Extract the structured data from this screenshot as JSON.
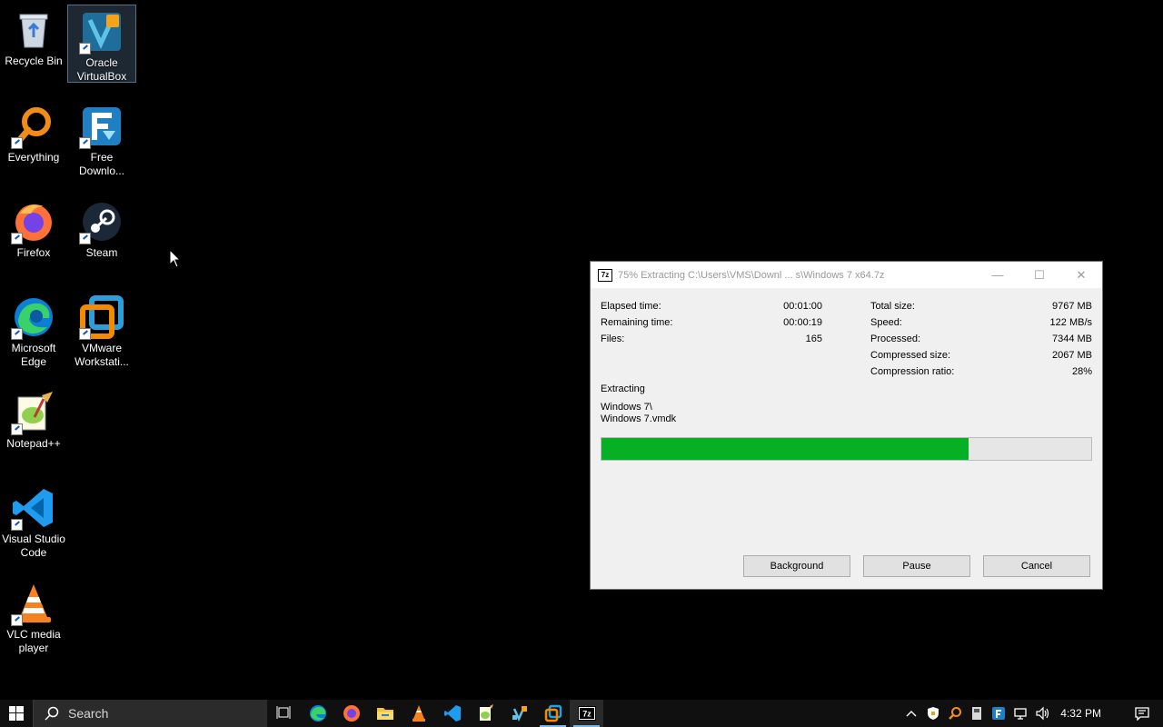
{
  "desktop": {
    "icons": [
      {
        "label": "Recycle Bin"
      },
      {
        "label": "Oracle VirtualBox"
      },
      {
        "label": "Everything"
      },
      {
        "label": "Free Downlo..."
      },
      {
        "label": "Firefox"
      },
      {
        "label": "Steam"
      },
      {
        "label": "Microsoft Edge"
      },
      {
        "label": "VMware Workstati..."
      },
      {
        "label": "Notepad++"
      },
      {
        "label": "Visual Studio Code"
      },
      {
        "label": "VLC media player"
      }
    ]
  },
  "dialog": {
    "app_icon_text": "7z",
    "title": "75% Extracting C:\\Users\\VMS\\Downl ... s\\Windows 7 x64.7z",
    "controls": {
      "minimize": "—",
      "maximize": "☐",
      "close": "✕"
    },
    "left_stats": [
      {
        "label": "Elapsed time:",
        "value": "00:01:00"
      },
      {
        "label": "Remaining time:",
        "value": "00:00:19"
      },
      {
        "label": "Files:",
        "value": "165"
      }
    ],
    "right_stats": [
      {
        "label": "Total size:",
        "value": "9767 MB"
      },
      {
        "label": "Speed:",
        "value": "122 MB/s"
      },
      {
        "label": "Processed:",
        "value": "7344 MB"
      },
      {
        "label": "Compressed size:",
        "value": "2067 MB"
      },
      {
        "label": "Compression ratio:",
        "value": "28%"
      }
    ],
    "status": "Extracting",
    "path_line1": "Windows 7\\",
    "path_line2": "Windows 7.vmdk",
    "progress": 0.75,
    "progress_color": "#06b025",
    "buttons": {
      "background": "Background",
      "pause": "Pause",
      "cancel": "Cancel"
    }
  },
  "taskbar": {
    "search_placeholder": "Search",
    "pinned": [
      "task-view-icon",
      "edge-icon",
      "firefox-icon",
      "file-explorer-icon",
      "vlc-icon",
      "vscode-icon",
      "notepad-plus-plus-icon",
      "virtualbox-icon",
      "vmware-icon",
      "7zip-icon"
    ],
    "clock": "4:32 PM"
  }
}
